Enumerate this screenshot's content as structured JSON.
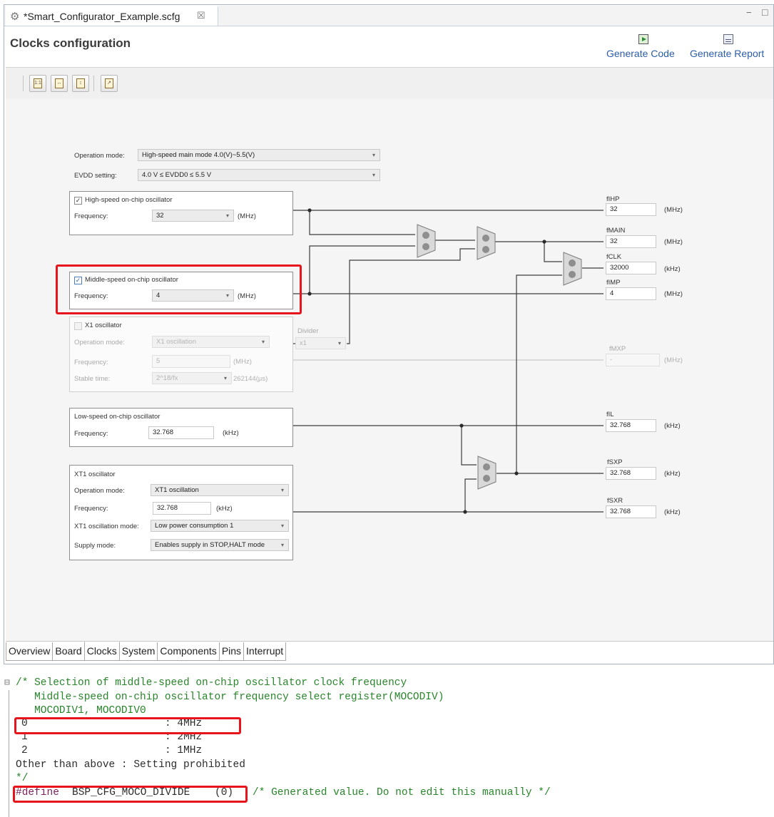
{
  "file_tab": {
    "title": "*Smart_Configurator_Example.scfg",
    "close_glyph": "☒"
  },
  "window_controls": {
    "minimize": "−",
    "maximize": "□"
  },
  "page_title": "Clocks configuration",
  "actions": {
    "generate_code": "Generate Code",
    "generate_report": "Generate Report"
  },
  "toolbar": {
    "icons": [
      "fit-to-window-icon",
      "fit-width-icon",
      "fit-height-icon",
      "export-icon"
    ]
  },
  "top_settings": {
    "operation_mode_label": "Operation mode:",
    "operation_mode_value": "High-speed main mode 4.0(V)~5.5(V)",
    "evdd_label": "EVDD setting:",
    "evdd_value": "4.0 V ≤ EVDD0 ≤ 5.5 V"
  },
  "hs_osc": {
    "title": "High-speed on-chip oscillator",
    "checked": true,
    "freq_label": "Frequency:",
    "freq_value": "32",
    "unit": "(MHz)"
  },
  "ms_osc": {
    "title": "Middle-speed on-chip oscillator",
    "checked": true,
    "freq_label": "Frequency:",
    "freq_value": "4",
    "unit": "(MHz)"
  },
  "x1_osc": {
    "title": "X1 oscillator",
    "checked": false,
    "mode_label": "Operation mode:",
    "mode_value": "X1 oscillation",
    "freq_label": "Frequency:",
    "freq_value": "5",
    "freq_unit": "(MHz)",
    "stable_label": "Stable time:",
    "stable_value": "2^18/fx",
    "stable_extra": "262144(μs)",
    "divider_label": "Divider",
    "divider_value": "x1"
  },
  "ls_osc": {
    "title": "Low-speed on-chip oscillator",
    "freq_label": "Frequency:",
    "freq_value": "32.768",
    "unit": "(kHz)"
  },
  "xt1_osc": {
    "title": "XT1 oscillator",
    "mode_label": "Operation mode:",
    "mode_value": "XT1 oscillation",
    "freq_label": "Frequency:",
    "freq_value": "32.768",
    "freq_unit": "(kHz)",
    "osc_mode_label": "XT1 oscillation mode:",
    "osc_mode_value": "Low power consumption 1",
    "supply_label": "Supply mode:",
    "supply_value": "Enables supply in STOP,HALT mode"
  },
  "outputs": [
    {
      "name": "fIHP",
      "value": "32",
      "unit": "(MHz)",
      "disabled": false
    },
    {
      "name": "fMAIN",
      "value": "32",
      "unit": "(MHz)",
      "disabled": false
    },
    {
      "name": "fCLK",
      "value": "32000",
      "unit": "(kHz)",
      "disabled": false
    },
    {
      "name": "fIMP",
      "value": "4",
      "unit": "(MHz)",
      "disabled": false
    },
    {
      "name": "fMXP",
      "value": "-",
      "unit": "(MHz)",
      "disabled": true
    },
    {
      "name": "fIL",
      "value": "32.768",
      "unit": "(kHz)",
      "disabled": false
    },
    {
      "name": "fSXP",
      "value": "32.768",
      "unit": "(kHz)",
      "disabled": false
    },
    {
      "name": "fSXR",
      "value": "32.768",
      "unit": "(kHz)",
      "disabled": false
    }
  ],
  "bottom_tabs": [
    "Overview",
    "Board",
    "Clocks",
    "System",
    "Components",
    "Pins",
    "Interrupt"
  ],
  "code": {
    "fold_glyph": "⊟",
    "line1": "/* Selection of middle-speed on-chip oscillator clock frequency",
    "line2": "   Middle-speed on-chip oscillator frequency select register(MOCODIV)",
    "line3": "   MOCODIV1, MOCODIV0",
    "row0_code": "0",
    "row0_desc": ": 4MHz",
    "row1_code": "1",
    "row1_desc": ": 2MHz",
    "row2_code": "2",
    "row2_desc": ": 1MHz",
    "row_other": "Other than above : Setting prohibited",
    "close_comment": "*/",
    "define_kw": "#define",
    "define_name": "BSP_CFG_MOCO_DIVIDE",
    "define_val": "(0)",
    "define_comment": "/* Generated value. Do not edit this manually */"
  }
}
